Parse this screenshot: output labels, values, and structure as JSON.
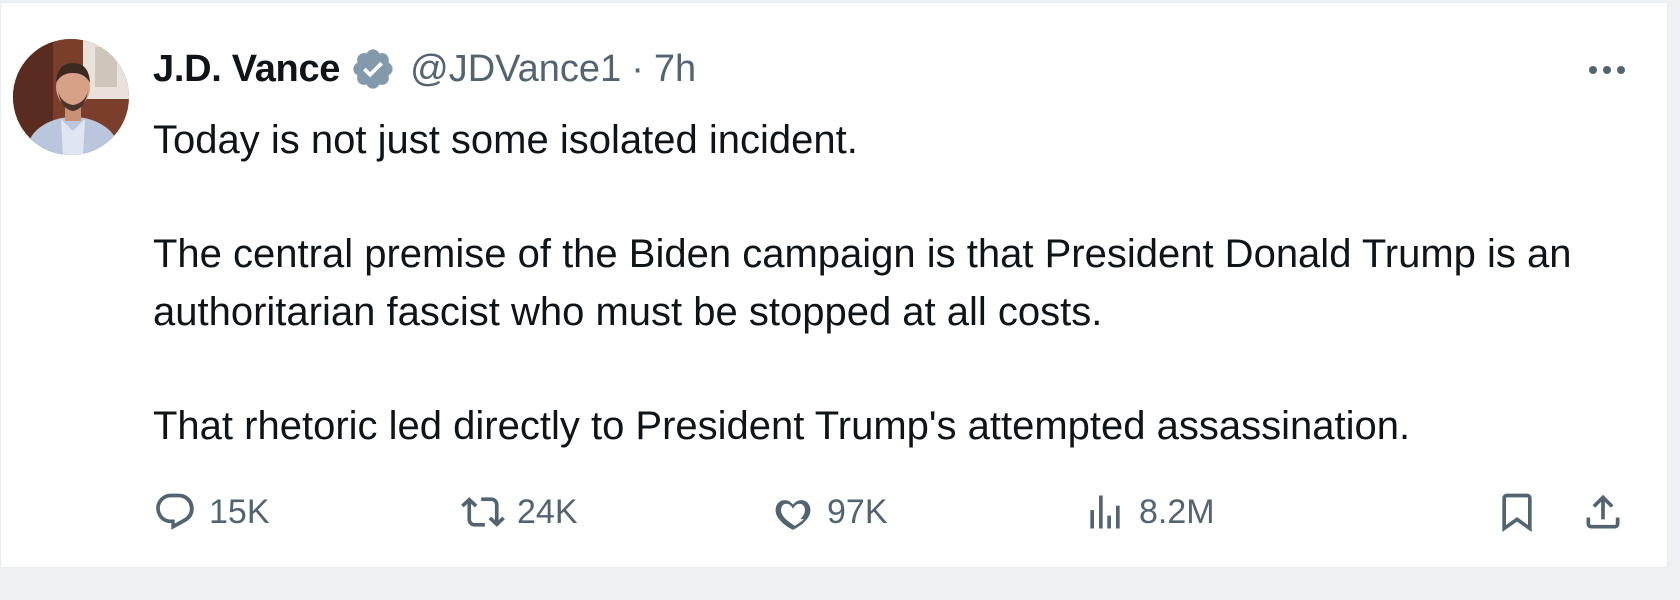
{
  "author": {
    "name": "J.D. Vance",
    "handle": "@JDVance1",
    "separator": "·",
    "time": "7h",
    "verified_color": "#829aab"
  },
  "tweet": {
    "paragraphs": [
      "Today is not just some isolated incident.",
      "The central premise of the Biden campaign is that President Donald Trump is an authoritarian fascist who must be stopped at all costs.",
      "That rhetoric led directly to President Trump's attempted assassination."
    ]
  },
  "actions": {
    "replies": "15K",
    "reposts": "24K",
    "likes": "97K",
    "views": "8.2M"
  },
  "icons": {
    "reply": "reply-icon",
    "repost": "repost-icon",
    "like": "heart-icon",
    "views": "views-icon",
    "bookmark": "bookmark-icon",
    "share": "share-icon",
    "more": "more-icon",
    "verified": "verified-badge-icon"
  },
  "colors": {
    "text": "#0f1419",
    "secondary": "#536471",
    "background": "#ffffff"
  }
}
